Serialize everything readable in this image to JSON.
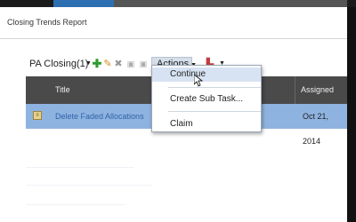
{
  "panel": {
    "title": "Closing Trends Report"
  },
  "toolbar": {
    "name": "PA Closing(1)",
    "actions_label": "Actions",
    "icons": [
      "plus-icon",
      "pencil-icon",
      "delete-icon",
      "square-icon",
      "square-icon",
      "chart-icon"
    ]
  },
  "table": {
    "columns": [
      "Title",
      "Assigned"
    ],
    "rows": [
      {
        "title": "Delete Faded Allocations",
        "assigned": "Oct 21, 2014"
      }
    ]
  },
  "menu": {
    "items": [
      "Continue",
      "Create Sub Task...",
      "Claim"
    ],
    "highlighted": "Continue"
  },
  "colors": {
    "header_bg": "#4a4a4a",
    "selected_row": "#8fb3e0",
    "accent": "#2d6fb0"
  }
}
